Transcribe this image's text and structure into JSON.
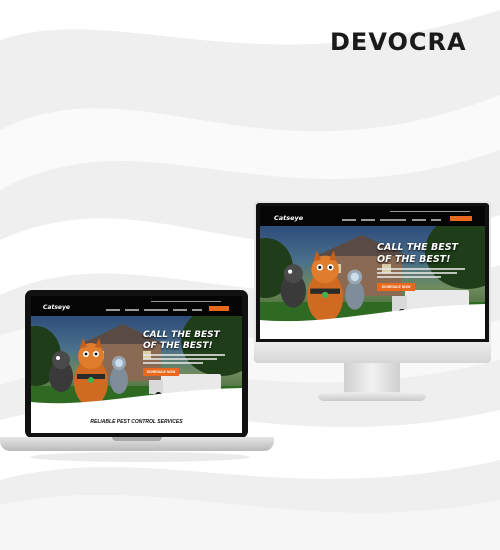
{
  "brand": {
    "name": "DEVOCRA"
  },
  "site": {
    "logo": "Catseye",
    "headline_line1": "CALL THE BEST",
    "headline_line2": "OF THE BEST!",
    "cta_label": "SCHEDULE NOW",
    "section_title": "RELIABLE PEST CONTROL SERVICES"
  },
  "colors": {
    "accent": "#e8691e",
    "background": "#f1f1f1",
    "brand_text": "#1a1a1a",
    "screen": "#0c0c0c"
  },
  "devices": [
    "laptop",
    "desktop-monitor"
  ]
}
